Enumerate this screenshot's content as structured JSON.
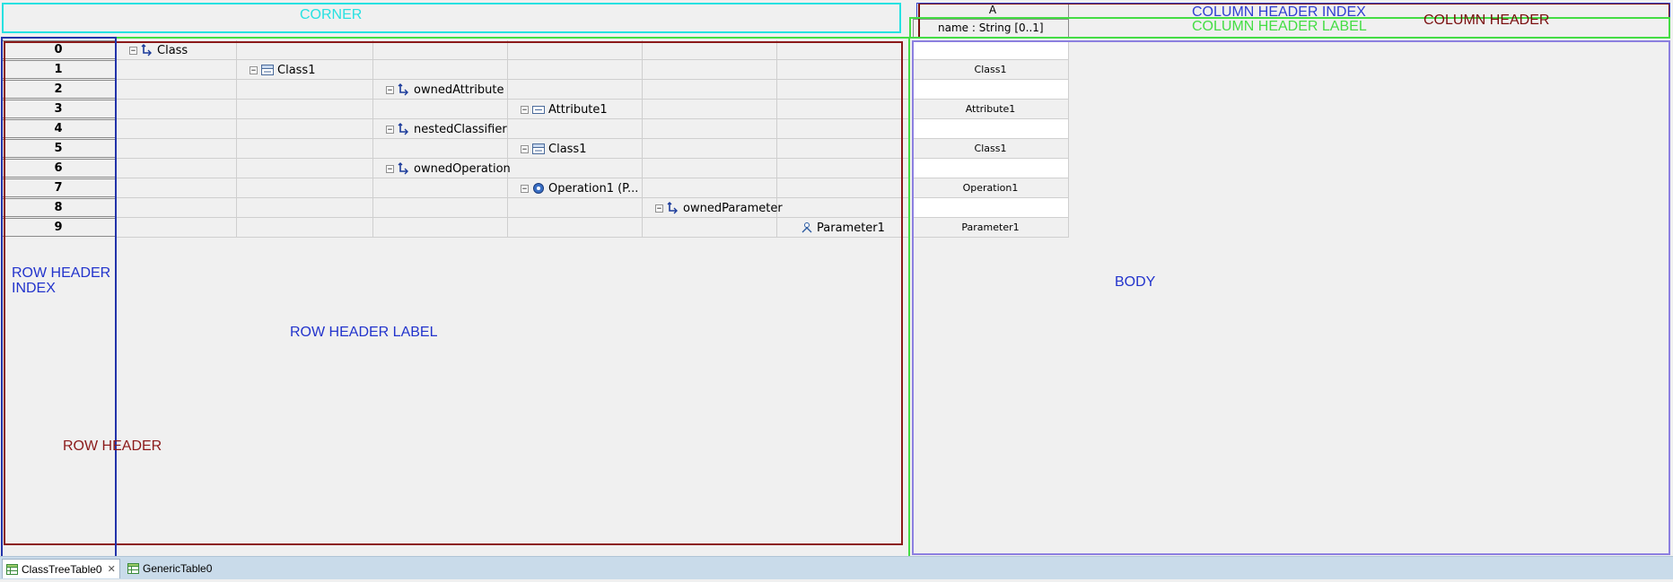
{
  "corner": {
    "label": "CORNER"
  },
  "column_header": {
    "index": "A",
    "label": "name : String [0..1]",
    "index_overlay": "COLUMN HEADER INDEX",
    "label_overlay": "COLUMN HEADER LABEL",
    "overlay": "COLUMN HEADER"
  },
  "row_header": {
    "index_overlay": "ROW HEADER\nINDEX",
    "label_overlay": "ROW HEADER LABEL",
    "overlay": "ROW HEADER"
  },
  "body": {
    "overlay": "BODY"
  },
  "rows": [
    {
      "index": "0",
      "label": "Class",
      "icon": "feature-icon",
      "value": ""
    },
    {
      "index": "1",
      "label": "Class1",
      "icon": "class-icon",
      "value": "Class1"
    },
    {
      "index": "2",
      "label": "ownedAttribute",
      "icon": "feature-icon",
      "value": ""
    },
    {
      "index": "3",
      "label": "Attribute1",
      "icon": "attribute-icon",
      "value": "Attribute1"
    },
    {
      "index": "4",
      "label": "nestedClassifier",
      "icon": "feature-icon",
      "value": ""
    },
    {
      "index": "5",
      "label": "Class1",
      "icon": "class-icon",
      "value": "Class1"
    },
    {
      "index": "6",
      "label": "ownedOperation",
      "icon": "feature-icon",
      "value": ""
    },
    {
      "index": "7",
      "label": "Operation1 (P...",
      "icon": "operation-icon",
      "value": "Operation1"
    },
    {
      "index": "8",
      "label": "ownedParameter",
      "icon": "feature-icon",
      "value": ""
    },
    {
      "index": "9",
      "label": "Parameter1",
      "icon": "parameter-icon",
      "value": "Parameter1"
    }
  ],
  "tabs": [
    {
      "label": "ClassTreeTable0",
      "active": true
    },
    {
      "label": "GenericTable0",
      "active": false
    }
  ],
  "colors": {
    "corner_outline": "#27e1e1",
    "column_header_index_outline": "#3344cc",
    "column_header_label_outline": "#44dd44",
    "column_header_outline": "#7a1010",
    "row_header_index_outline": "#2233aa",
    "row_header_label_outline": "#44dd44",
    "row_header_outline": "#8b1a1a",
    "body_outline": "#8c7fe0"
  }
}
